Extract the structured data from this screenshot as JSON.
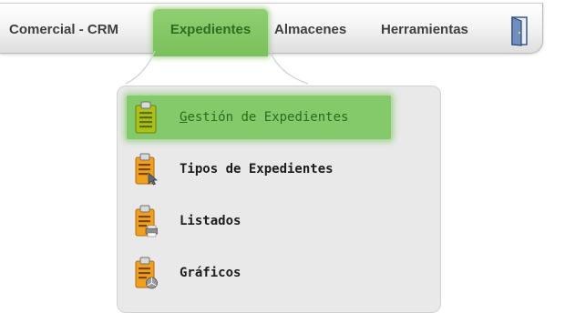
{
  "menubar": {
    "items": [
      {
        "label": "Comercial - CRM"
      },
      {
        "label": "Expedientes",
        "active": true
      },
      {
        "label": "Almacenes"
      },
      {
        "label": "Herramientas"
      }
    ],
    "exit_icon": "door-exit-icon"
  },
  "dropdown": {
    "items": [
      {
        "label_first": "G",
        "label_rest": "estión de Expedientes",
        "icon": "clipboard-list-icon",
        "active": true
      },
      {
        "label": "Tipos de Expedientes",
        "icon": "clipboard-cursor-icon"
      },
      {
        "label": "Listados",
        "icon": "clipboard-printer-icon"
      },
      {
        "label": "Gráficos",
        "icon": "clipboard-piechart-icon"
      }
    ]
  },
  "colors": {
    "active_green": "#84c96a",
    "active_text": "#2a6d1c",
    "clipboard_orange": "#f0a020",
    "clipboard_green": "#a8c21a"
  }
}
